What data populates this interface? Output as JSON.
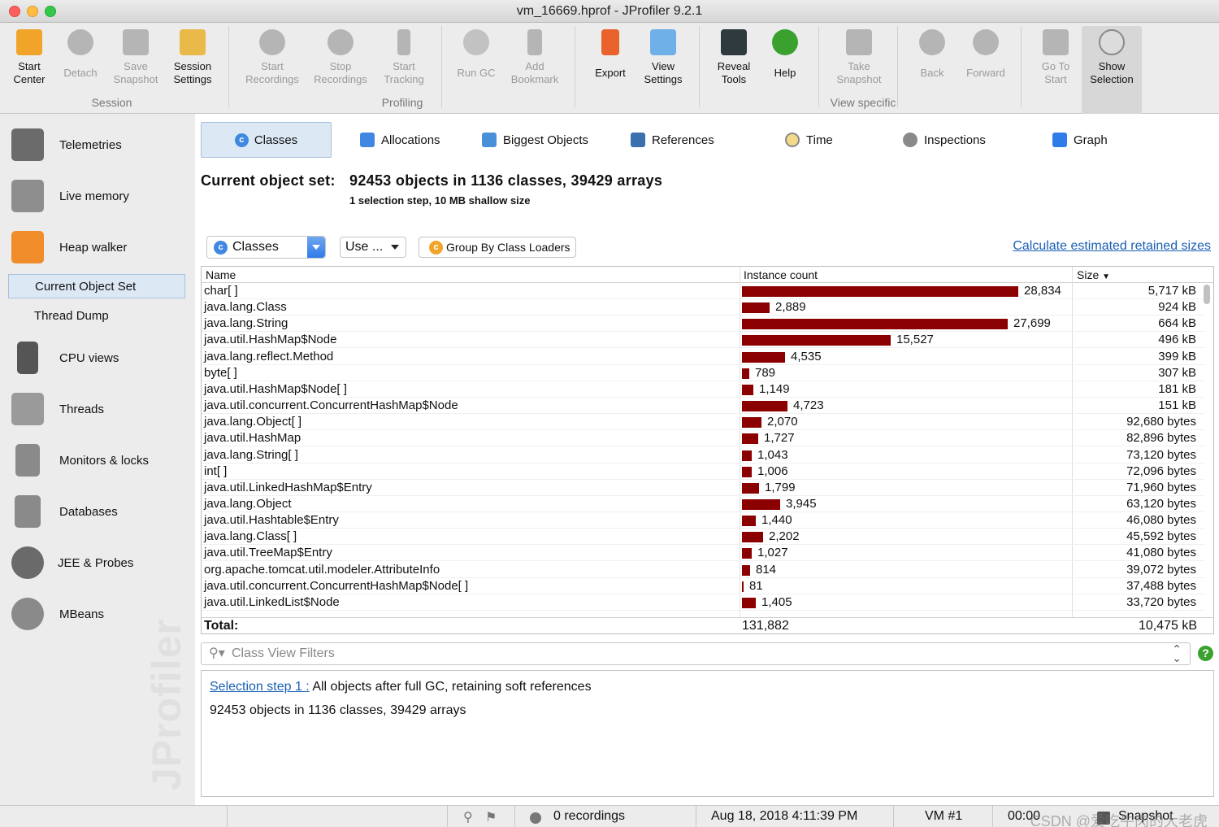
{
  "window": {
    "title": "vm_16669.hprof - JProfiler 9.2.1"
  },
  "toolbar": {
    "buttons": [
      {
        "label": "Start\nCenter",
        "icon": "start-center-icon",
        "enabled": true
      },
      {
        "label": "Detach",
        "icon": "detach-icon",
        "enabled": false
      },
      {
        "label": "Save\nSnapshot",
        "icon": "save-icon",
        "enabled": false
      },
      {
        "label": "Session\nSettings",
        "icon": "session-settings-icon",
        "enabled": true
      },
      {
        "label": "Start\nRecordings",
        "icon": "start-recordings-icon",
        "enabled": false
      },
      {
        "label": "Stop\nRecordings",
        "icon": "stop-recordings-icon",
        "enabled": false
      },
      {
        "label": "Start\nTracking",
        "icon": "start-tracking-icon",
        "enabled": false
      },
      {
        "label": "Run GC",
        "icon": "run-gc-icon",
        "enabled": false
      },
      {
        "label": "Add\nBookmark",
        "icon": "bookmark-icon",
        "enabled": false
      },
      {
        "label": "Export",
        "icon": "export-icon",
        "enabled": true
      },
      {
        "label": "View\nSettings",
        "icon": "view-settings-icon",
        "enabled": true
      },
      {
        "label": "Reveal\nTools",
        "icon": "reveal-tools-icon",
        "enabled": true
      },
      {
        "label": "Help",
        "icon": "help-icon",
        "enabled": true
      },
      {
        "label": "Take\nSnapshot",
        "icon": "camera-icon",
        "enabled": false
      },
      {
        "label": "Back",
        "icon": "back-icon",
        "enabled": false
      },
      {
        "label": "Forward",
        "icon": "forward-icon",
        "enabled": false
      },
      {
        "label": "Go To\nStart",
        "icon": "home-icon",
        "enabled": false
      },
      {
        "label": "Show\nSelection",
        "icon": "show-selection-icon",
        "enabled": true,
        "selected": true
      }
    ],
    "groups": [
      "Session",
      "Profiling",
      "View specific"
    ]
  },
  "sidebar": {
    "items": [
      {
        "label": "Telemetries",
        "icon": "telemetries-icon"
      },
      {
        "label": "Live memory",
        "icon": "live-memory-icon"
      },
      {
        "label": "Heap walker",
        "icon": "heap-walker-icon"
      },
      {
        "label": "CPU views",
        "icon": "cpu-icon"
      },
      {
        "label": "Threads",
        "icon": "threads-icon"
      },
      {
        "label": "Monitors & locks",
        "icon": "lock-icon"
      },
      {
        "label": "Databases",
        "icon": "database-icon"
      },
      {
        "label": "JEE & Probes",
        "icon": "probes-icon"
      },
      {
        "label": "MBeans",
        "icon": "mbeans-icon"
      }
    ],
    "sub_items": [
      {
        "label": "Current Object Set",
        "selected": true
      },
      {
        "label": "Thread Dump",
        "selected": false
      }
    ],
    "watermark": "JProfiler"
  },
  "view_tabs": [
    {
      "label": "Classes",
      "icon": "classes-icon",
      "selected": true
    },
    {
      "label": "Allocations",
      "icon": "allocations-icon"
    },
    {
      "label": "Biggest Objects",
      "icon": "biggest-objects-icon"
    },
    {
      "label": "References",
      "icon": "references-icon"
    },
    {
      "label": "Time",
      "icon": "clock-icon"
    },
    {
      "label": "Inspections",
      "icon": "gear-icon"
    },
    {
      "label": "Graph",
      "icon": "graph-icon"
    }
  ],
  "object_set": {
    "label": "Current object set:",
    "summary": "92453 objects in 1136 classes, 39429 arrays",
    "detail": "1 selection step, 10 MB shallow size"
  },
  "controls": {
    "view_combo": "Classes",
    "use_button": "Use ...",
    "group_button": "Group By Class Loaders",
    "calc_link": "Calculate estimated retained sizes"
  },
  "table": {
    "headers": {
      "name": "Name",
      "count": "Instance count",
      "size": "Size"
    },
    "max_count": 28834,
    "rows": [
      {
        "name": "char[ ]",
        "count": 28834,
        "count_text": "28,834",
        "size": "5,717 kB"
      },
      {
        "name": "java.lang.Class",
        "count": 2889,
        "count_text": "2,889",
        "size": "924 kB"
      },
      {
        "name": "java.lang.String",
        "count": 27699,
        "count_text": "27,699",
        "size": "664 kB"
      },
      {
        "name": "java.util.HashMap$Node",
        "count": 15527,
        "count_text": "15,527",
        "size": "496 kB"
      },
      {
        "name": "java.lang.reflect.Method",
        "count": 4535,
        "count_text": "4,535",
        "size": "399 kB"
      },
      {
        "name": "byte[ ]",
        "count": 789,
        "count_text": "789",
        "size": "307 kB"
      },
      {
        "name": "java.util.HashMap$Node[ ]",
        "count": 1149,
        "count_text": "1,149",
        "size": "181 kB"
      },
      {
        "name": "java.util.concurrent.ConcurrentHashMap$Node",
        "count": 4723,
        "count_text": "4,723",
        "size": "151 kB"
      },
      {
        "name": "java.lang.Object[ ]",
        "count": 2070,
        "count_text": "2,070",
        "size": "92,680 bytes"
      },
      {
        "name": "java.util.HashMap",
        "count": 1727,
        "count_text": "1,727",
        "size": "82,896 bytes"
      },
      {
        "name": "java.lang.String[ ]",
        "count": 1043,
        "count_text": "1,043",
        "size": "73,120 bytes"
      },
      {
        "name": "int[ ]",
        "count": 1006,
        "count_text": "1,006",
        "size": "72,096 bytes"
      },
      {
        "name": "java.util.LinkedHashMap$Entry",
        "count": 1799,
        "count_text": "1,799",
        "size": "71,960 bytes"
      },
      {
        "name": "java.lang.Object",
        "count": 3945,
        "count_text": "3,945",
        "size": "63,120 bytes"
      },
      {
        "name": "java.util.Hashtable$Entry",
        "count": 1440,
        "count_text": "1,440",
        "size": "46,080 bytes"
      },
      {
        "name": "java.lang.Class[ ]",
        "count": 2202,
        "count_text": "2,202",
        "size": "45,592 bytes"
      },
      {
        "name": "java.util.TreeMap$Entry",
        "count": 1027,
        "count_text": "1,027",
        "size": "41,080 bytes"
      },
      {
        "name": "org.apache.tomcat.util.modeler.AttributeInfo",
        "count": 814,
        "count_text": "814",
        "size": "39,072 bytes"
      },
      {
        "name": "java.util.concurrent.ConcurrentHashMap$Node[ ]",
        "count": 81,
        "count_text": "81",
        "size": "37,488 bytes"
      },
      {
        "name": "java.util.LinkedList$Node",
        "count": 1405,
        "count_text": "1,405",
        "size": "33,720 bytes"
      }
    ],
    "total": {
      "label": "Total:",
      "count": "131,882",
      "size": "10,475 kB"
    },
    "bar_color": "#8b0000"
  },
  "filter": {
    "placeholder": "Class View Filters"
  },
  "steps": {
    "link": "Selection step 1 :",
    "description": "All objects after full GC, retaining soft references",
    "summary": "92453 objects in 1136 classes, 39429 arrays"
  },
  "status": {
    "recordings": "0 recordings",
    "datetime": "Aug 18, 2018 4:11:39 PM",
    "vm": "VM #1",
    "elapsed": "00:00",
    "mode": "Snapshot",
    "watermark": "CSDN @爱吃牛肉的大老虎"
  }
}
